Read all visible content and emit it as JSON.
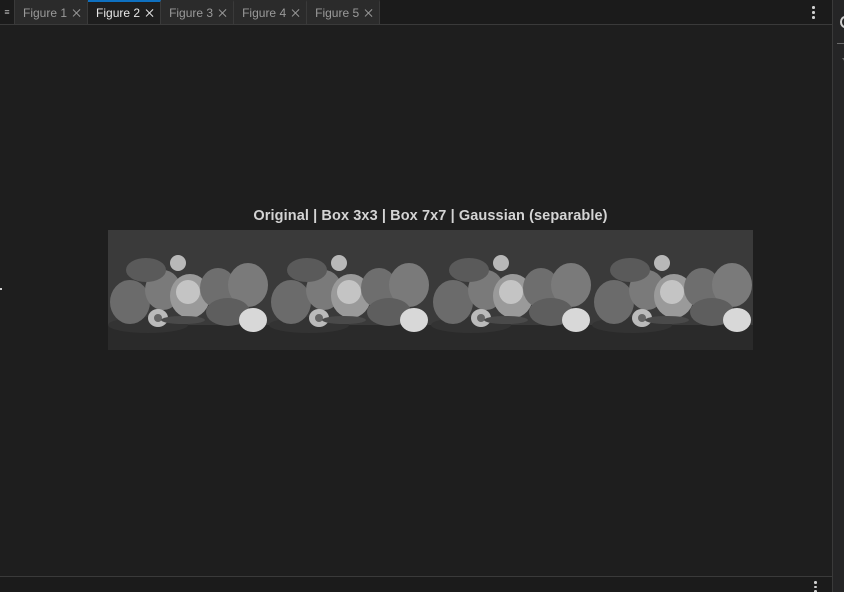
{
  "tabs": [
    {
      "label": "Figure 1",
      "active": false
    },
    {
      "label": "Figure 2",
      "active": true
    },
    {
      "label": "Figure 3",
      "active": false
    },
    {
      "label": "Figure 4",
      "active": false
    },
    {
      "label": "Figure 5",
      "active": false
    }
  ],
  "figure": {
    "title": "Original | Box 3x3 | Box 7x7 | Gaussian (separable)",
    "panels": [
      "Original",
      "Box 3x3",
      "Box 7x7",
      "Gaussian (separable)"
    ]
  },
  "colors": {
    "background": "#1e1e1e",
    "tab_active_accent": "#0e70c0",
    "title_text": "#d4d4d4"
  },
  "icons": {
    "tab_menu": "hamburger-icon",
    "tab_close": "close-icon",
    "more": "vertical-ellipsis-icon"
  }
}
